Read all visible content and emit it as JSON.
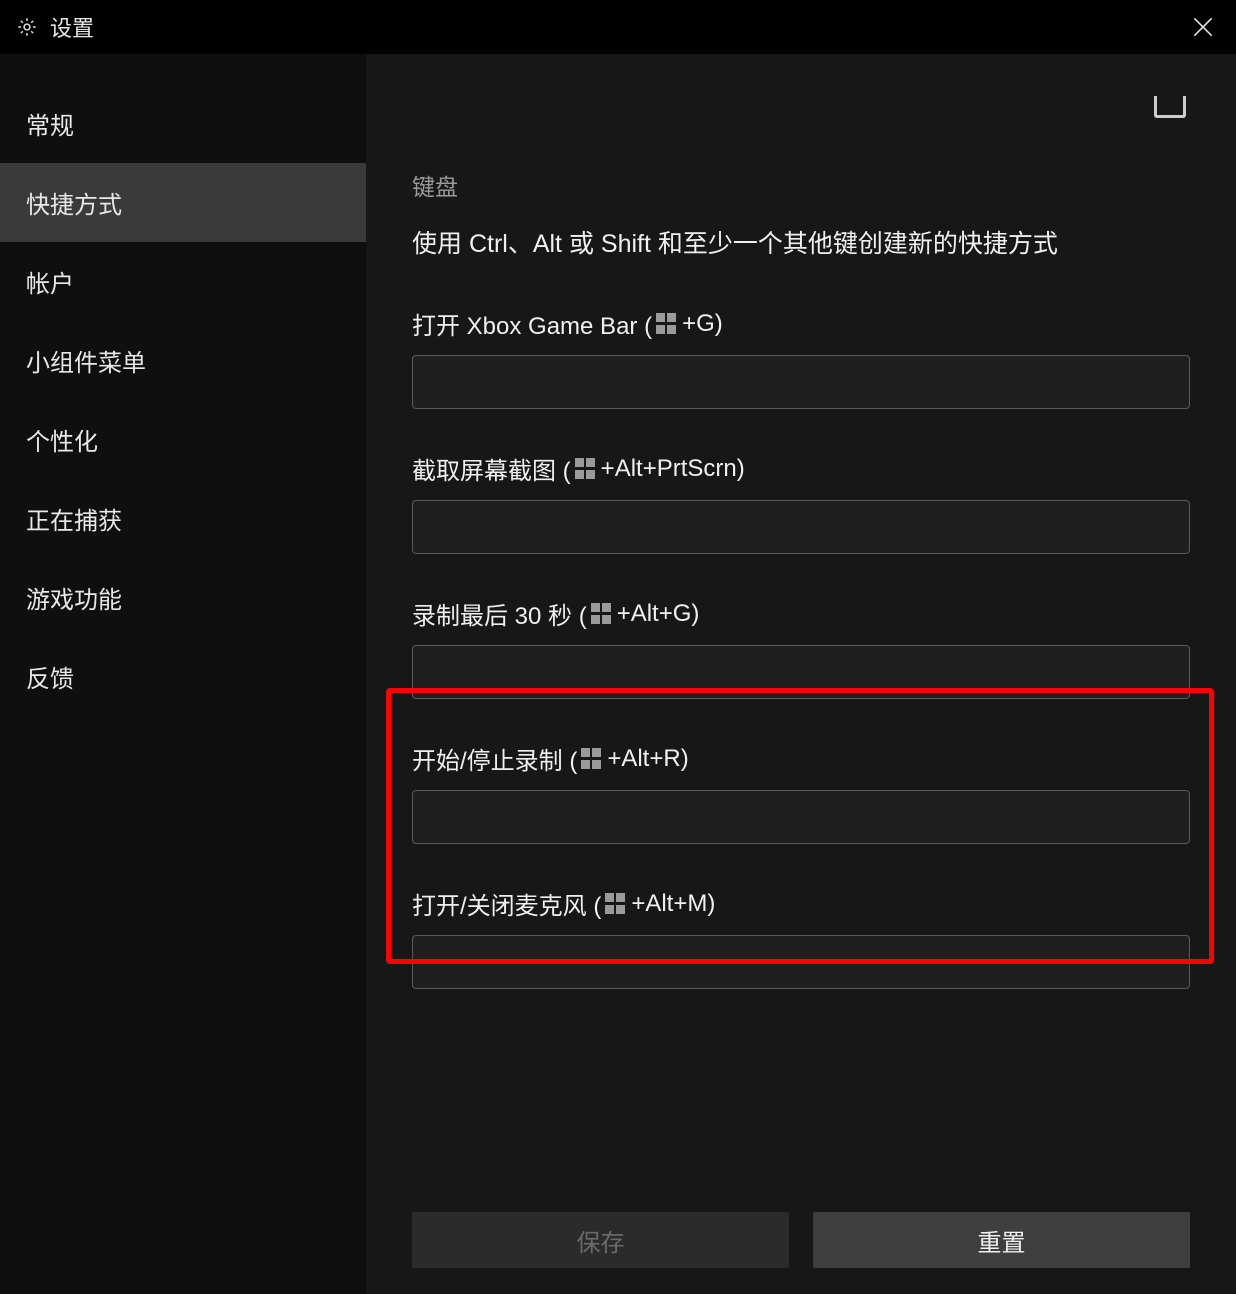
{
  "header": {
    "title": "设置"
  },
  "sidebar": {
    "items": [
      {
        "label": "常规"
      },
      {
        "label": "快捷方式"
      },
      {
        "label": "帐户"
      },
      {
        "label": "小组件菜单"
      },
      {
        "label": "个性化"
      },
      {
        "label": "正在捕获"
      },
      {
        "label": "游戏功能"
      },
      {
        "label": "反馈"
      }
    ],
    "active_index": 1
  },
  "main": {
    "section_heading": "键盘",
    "section_desc": "使用 Ctrl、Alt 或 Shift 和至少一个其他键创建新的快捷方式",
    "fields": [
      {
        "label_pre": "打开 Xbox Game Bar (",
        "label_post": " +G)",
        "value": ""
      },
      {
        "label_pre": "截取屏幕截图 (",
        "label_post": " +Alt+PrtScrn)",
        "value": ""
      },
      {
        "label_pre": "录制最后 30 秒 (",
        "label_post": " +Alt+G)",
        "value": ""
      },
      {
        "label_pre": "开始/停止录制 (",
        "label_post": " +Alt+R)",
        "value": ""
      },
      {
        "label_pre": "打开/关闭麦克风 (",
        "label_post": " +Alt+M)",
        "value": ""
      }
    ],
    "buttons": {
      "save": "保存",
      "reset": "重置"
    }
  }
}
